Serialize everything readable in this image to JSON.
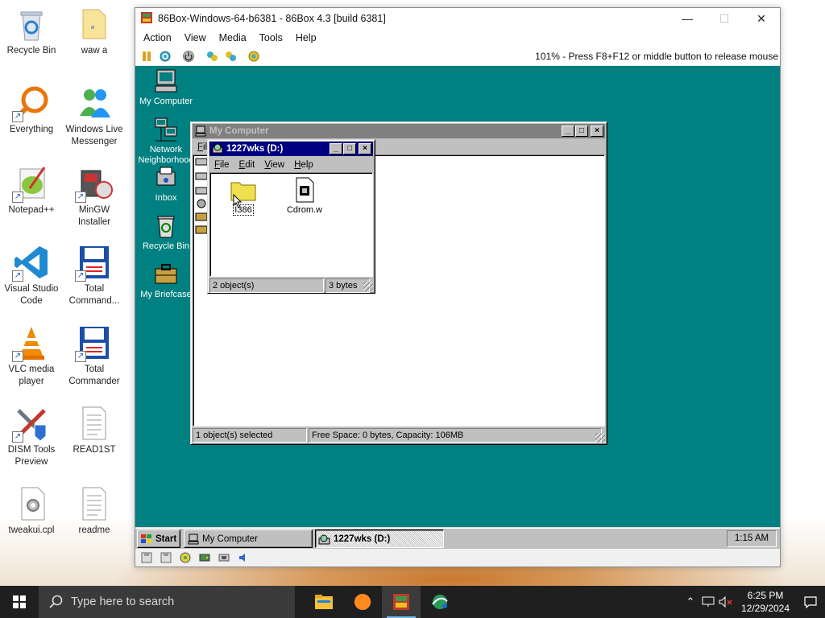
{
  "host_desktop": {
    "icons": [
      {
        "label": "Recycle Bin",
        "icon": "recycle-bin-icon"
      },
      {
        "label": "waw a",
        "icon": "folder-icon"
      },
      {
        "label": "Everything",
        "icon": "everything-search-icon"
      },
      {
        "label": "Windows Live Messenger",
        "icon": "messenger-icon"
      },
      {
        "label": "Notepad++",
        "icon": "notepad-plus-icon"
      },
      {
        "label": "MinGW Installer",
        "icon": "mingw-installer-icon"
      },
      {
        "label": "Visual Studio Code",
        "icon": "vscode-icon"
      },
      {
        "label": "Total Command...",
        "icon": "total-commander-64-icon"
      },
      {
        "label": "VLC media player",
        "icon": "vlc-icon"
      },
      {
        "label": "Total Commander",
        "icon": "total-commander-icon"
      },
      {
        "label": "DISM Tools Preview",
        "icon": "dism-tools-icon"
      },
      {
        "label": "READ1ST",
        "icon": "text-document-icon"
      },
      {
        "label": "tweakui.cpl",
        "icon": "control-panel-file-icon"
      },
      {
        "label": "readme",
        "icon": "text-document-icon"
      }
    ]
  },
  "box": {
    "title": "86Box-Windows-64-b6381 - 86Box 4.3 [build 6381]",
    "menu": [
      "Action",
      "View",
      "Media",
      "Tools",
      "Help"
    ],
    "status_right": "101% - Press F8+F12 or middle button to release mouse",
    "toolbar_icons": [
      "pause-icon",
      "reset-icon",
      "power-icon",
      "ctrl-alt-del-icon",
      "ctrl-alt-esc-icon",
      "settings-icon"
    ],
    "statusbar_icons": [
      "floppy-a-icon",
      "floppy-b-icon",
      "cdrom-icon",
      "hard-disk-icon",
      "network-icon",
      "sound-icon"
    ]
  },
  "emu": {
    "desktop_icons": [
      {
        "label": "My Computer",
        "icon": "my-computer-icon"
      },
      {
        "label": "Network Neighborhood",
        "icon": "network-neighborhood-icon"
      },
      {
        "label": "Inbox",
        "icon": "inbox-icon"
      },
      {
        "label": "Recycle Bin",
        "icon": "recycle-bin-icon"
      },
      {
        "label": "My Briefcase",
        "icon": "briefcase-icon"
      }
    ],
    "my_computer_window": {
      "title": "My Computer",
      "menu_visible": "Fil",
      "status_left": "1 object(s) selected",
      "status_right": "Free Space: 0 bytes,  Capacity: 106MB"
    },
    "cd_window": {
      "title": "1227wks (D:)",
      "menu": [
        "File",
        "Edit",
        "View",
        "Help"
      ],
      "items": [
        {
          "label": "I386",
          "icon": "folder-icon",
          "selected": true
        },
        {
          "label": "Cdrom.w",
          "icon": "document-file-icon",
          "selected": false
        }
      ],
      "status_left": "2 object(s)",
      "status_right": "3 bytes"
    },
    "taskbar": {
      "start": "Start",
      "buttons": [
        {
          "label": "My Computer",
          "pressed": false
        },
        {
          "label": "1227wks (D:)",
          "pressed": true
        }
      ],
      "clock": "1:15 AM"
    }
  },
  "host_taskbar": {
    "search_placeholder": "Type here to search",
    "apps": [
      "file-explorer-icon",
      "firefox-icon",
      "86box-icon",
      "network-app-icon"
    ],
    "clock_time": "6:25 PM",
    "clock_date": "12/29/2024"
  }
}
